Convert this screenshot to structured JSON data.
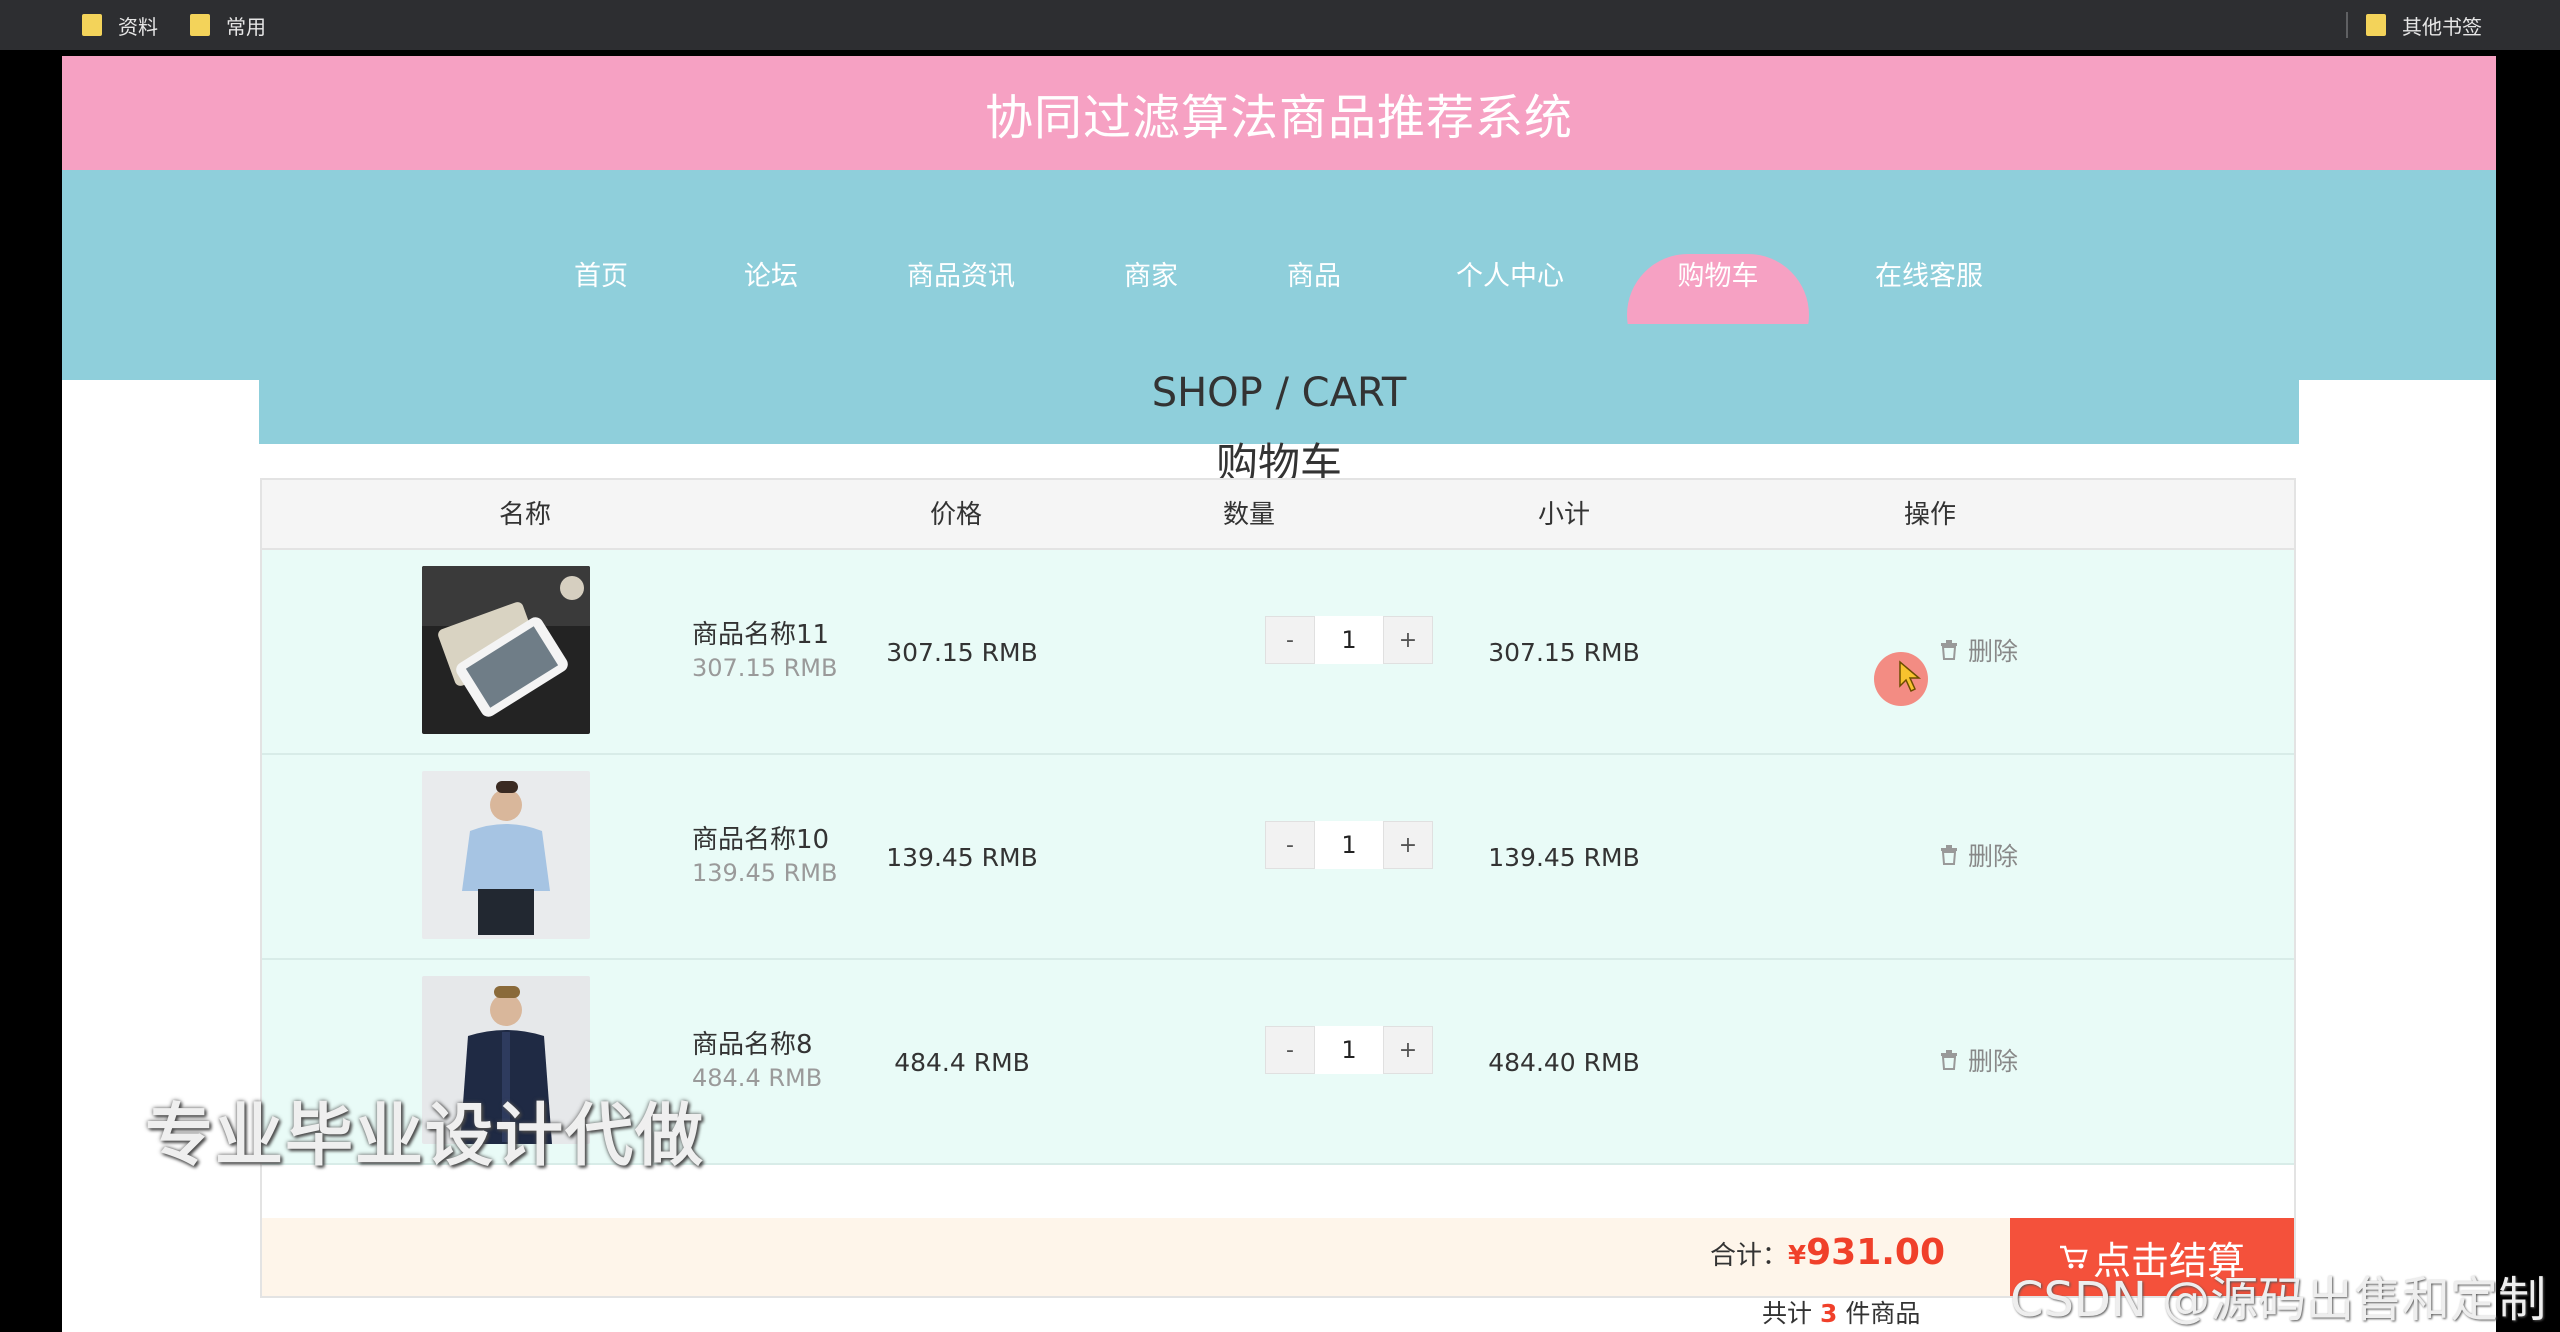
{
  "bookmarks": {
    "items": [
      "资料",
      "常用"
    ],
    "other": "其他书签"
  },
  "site": {
    "title": "协同过滤算法商品推荐系统"
  },
  "nav": {
    "items": [
      "首页",
      "论坛",
      "商品资讯",
      "商家",
      "商品",
      "个人中心",
      "购物车",
      "在线客服"
    ],
    "active": "购物车"
  },
  "banner": {
    "en": "SHOP / CART",
    "zh": "购物车"
  },
  "table": {
    "headers": [
      "名称",
      "价格",
      "数量",
      "小计",
      "操作"
    ],
    "rows": [
      {
        "name": "商品名称11",
        "price_small": "307.15 RMB",
        "price": "307.15 RMB",
        "qty": "1",
        "subtotal": "307.15 RMB",
        "delete": "删除"
      },
      {
        "name": "商品名称10",
        "price_small": "139.45 RMB",
        "price": "139.45 RMB",
        "qty": "1",
        "subtotal": "139.45 RMB",
        "delete": "删除"
      },
      {
        "name": "商品名称8",
        "price_small": "484.4 RMB",
        "price": "484.4 RMB",
        "qty": "1",
        "subtotal": "484.40 RMB",
        "delete": "删除"
      }
    ],
    "qty_minus": "-",
    "qty_plus": "+"
  },
  "footer": {
    "total_label": "合计：",
    "currency": "¥",
    "total": "931.00",
    "count_prefix": "共计",
    "count": "3",
    "count_suffix": "件商品",
    "checkout_label": "点击结算"
  },
  "watermarks": {
    "left": "专业毕业设计代做",
    "right": "CSDN @源码出售和定制"
  },
  "colors": {
    "pink": "#f6a1c3",
    "teal": "#8fcfdb",
    "row_bg": "#e9fbf7",
    "checkout": "#f4513b",
    "price_red": "#f0402a"
  }
}
